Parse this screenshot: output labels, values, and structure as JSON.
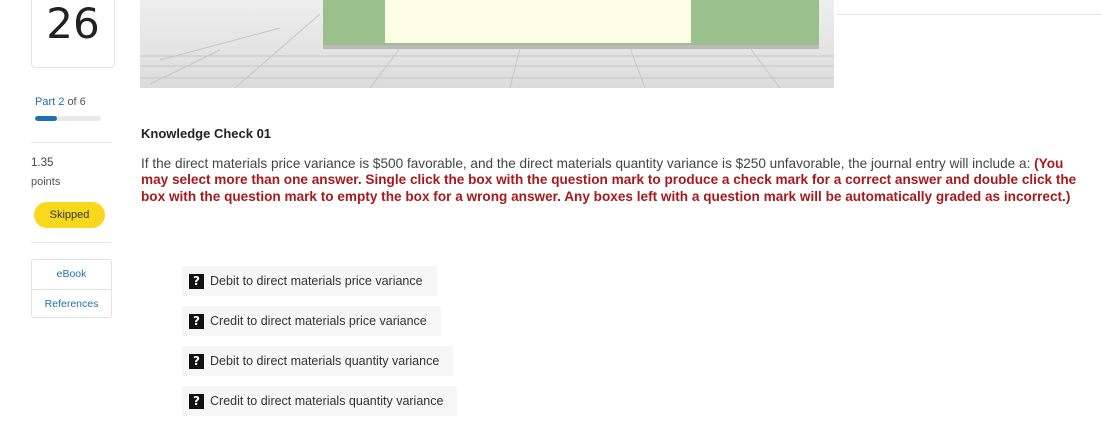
{
  "question": {
    "number": "26"
  },
  "part": {
    "label": "Part",
    "current": "2",
    "of_text": "of 6",
    "progress": 0.3333
  },
  "score": {
    "value": "1.35",
    "unit": "points"
  },
  "status": {
    "label": "Skipped",
    "color": "#f7d81c"
  },
  "resources": {
    "items": [
      "eBook",
      "References"
    ]
  },
  "content": {
    "title": "Knowledge Check 01",
    "question_text": "If the direct materials price variance is $500 favorable, and the direct materials quantity variance is $250 unfavorable, the journal entry will include a: ",
    "instructions": "(You may select more than one answer. Single click the box with the question mark to produce a check mark for a correct answer and double click the box with the question mark to empty the box for a wrong answer. Any boxes left with a question mark will be automatically graded as incorrect.)",
    "options": [
      {
        "marker": "?",
        "label": "Debit to direct materials price variance"
      },
      {
        "marker": "?",
        "label": "Credit to direct materials price variance"
      },
      {
        "marker": "?",
        "label": "Debit to direct materials quantity variance"
      },
      {
        "marker": "?",
        "label": "Credit to direct materials quantity variance"
      }
    ]
  },
  "colors": {
    "link": "#1f6fb5",
    "instructions": "#a8191d",
    "checkbox": "#111111"
  },
  "icons": {
    "option_marker": "question-mark-box-icon"
  }
}
